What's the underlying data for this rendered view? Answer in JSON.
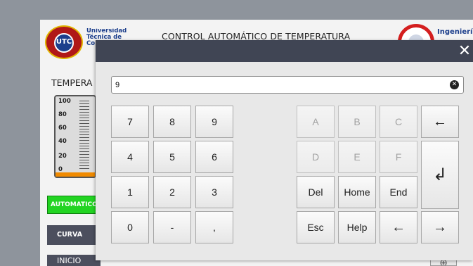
{
  "background_screen": {
    "university_text": "Universidad Técnica de Co",
    "title": "CONTROL AUTOMÁTICO DE TEMPERATURA",
    "faculty_text": "Ingenierí",
    "temperature_label": "TEMPERA",
    "thermometer": {
      "ticks": [
        "100",
        "80",
        "60",
        "40",
        "20",
        "0"
      ],
      "level_percent": 0
    },
    "buttons": {
      "automatico": "AUTOMATICO",
      "curva": "CURVA",
      "inicio": "INICIO"
    }
  },
  "keypad_dialog": {
    "close_icon": "close-icon",
    "input_value": "9",
    "clear_icon": "clear-icon",
    "numeric_keys": [
      "7",
      "8",
      "9",
      "4",
      "5",
      "6",
      "1",
      "2",
      "3",
      "0",
      "-",
      ","
    ],
    "hex_keys": [
      "A",
      "B",
      "C",
      "D",
      "E",
      "F"
    ],
    "control_keys": {
      "del": "Del",
      "home": "Home",
      "end": "End",
      "esc": "Esc",
      "help": "Help"
    },
    "arrow_keys": {
      "backspace": "←",
      "enter": "↲",
      "left": "←",
      "right": "→"
    }
  },
  "colors": {
    "dialog_title_bar": "#404554",
    "auto_button": "#22d422",
    "thermo_fill": "#f08a00"
  }
}
